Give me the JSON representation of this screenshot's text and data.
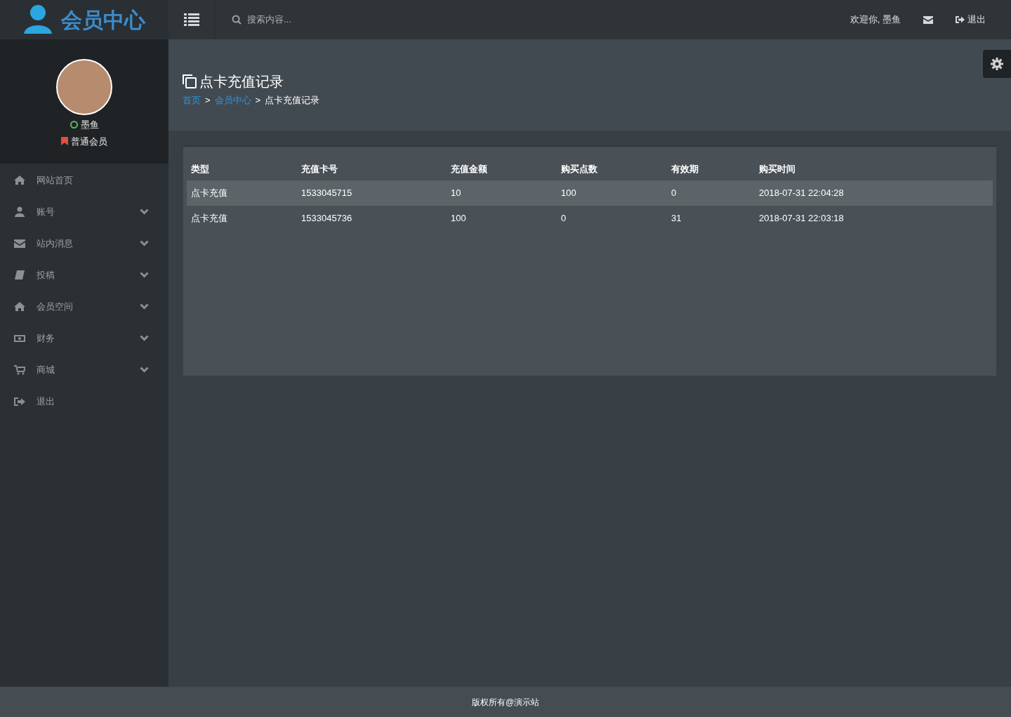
{
  "brand": {
    "title": "会员中心"
  },
  "topbar": {
    "search": {
      "placeholder": "搜索内容..."
    },
    "welcome": "欢迎你, 墨鱼",
    "logout": "退出"
  },
  "profile": {
    "name": "墨鱼",
    "online": true,
    "group": "普通会员"
  },
  "sidebar": {
    "items": [
      {
        "label": "网站首页",
        "has_submenu": false
      },
      {
        "label": "账号",
        "has_submenu": true
      },
      {
        "label": "站内消息",
        "has_submenu": true
      },
      {
        "label": "投稿",
        "has_submenu": true
      },
      {
        "label": "会员空间",
        "has_submenu": true
      },
      {
        "label": "财务",
        "has_submenu": true
      },
      {
        "label": "商城",
        "has_submenu": true
      },
      {
        "label": "退出",
        "has_submenu": false
      }
    ]
  },
  "page": {
    "title": "点卡充值记录",
    "breadcrumb": [
      {
        "label": "首页",
        "link": true
      },
      {
        "label": "会员中心",
        "link": true
      },
      {
        "label": "点卡充值记录",
        "link": false
      }
    ],
    "separator": ">"
  },
  "table": {
    "columns": [
      "类型",
      "充值卡号",
      "充值金额",
      "购买点数",
      "有效期",
      "购买时间"
    ],
    "rows": [
      {
        "cells": [
          "点卡充值",
          "1533045715",
          "10",
          "100",
          "0",
          "2018-07-31 22:04:28"
        ],
        "selected": true
      },
      {
        "cells": [
          "点卡充值",
          "1533045736",
          "100",
          "0",
          "31",
          "2018-07-31 22:03:18"
        ],
        "selected": false
      }
    ]
  },
  "footer": "版权所有@演示站"
}
